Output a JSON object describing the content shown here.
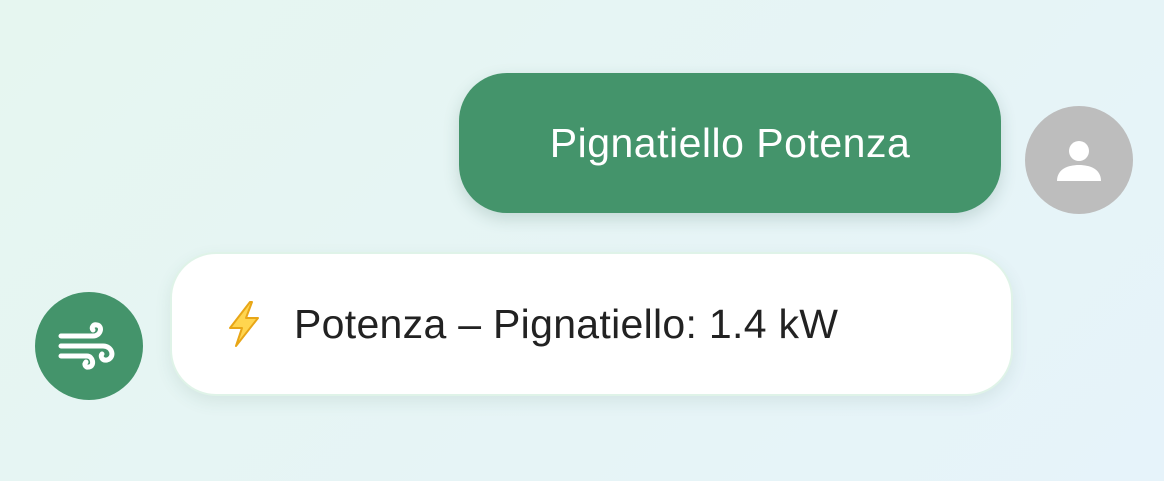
{
  "messages": {
    "user": {
      "text": "Pignatiello Potenza",
      "avatar_icon": "person-icon"
    },
    "bot": {
      "text": "Potenza – Pignatiello: 1.4 kW",
      "prefix_icon": "lightning-bolt-icon",
      "avatar_icon": "wind-icon"
    }
  },
  "colors": {
    "accent": "#44946b",
    "user_avatar_bg": "#bdbdbd",
    "bolt": "#f5b82e"
  }
}
